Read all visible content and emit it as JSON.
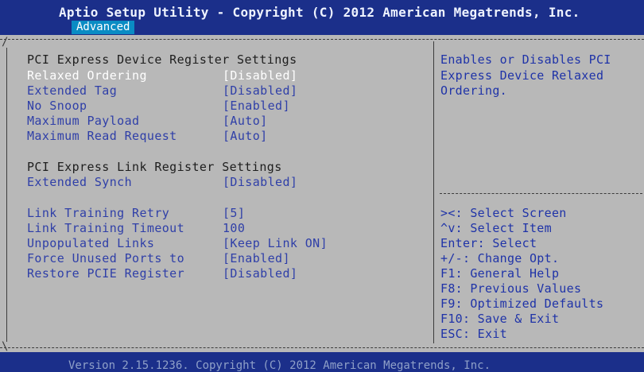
{
  "header": {
    "title": "Aptio Setup Utility - Copyright (C) 2012 American Megatrends, Inc.",
    "active_tab": "Advanced"
  },
  "settings": {
    "section1_title": "PCI Express Device Register Settings",
    "section2_title": "PCI Express Link Register Settings",
    "items": [
      {
        "label": "Relaxed Ordering",
        "value": "[Disabled]"
      },
      {
        "label": "Extended Tag",
        "value": "[Disabled]"
      },
      {
        "label": "No Snoop",
        "value": "[Enabled]"
      },
      {
        "label": "Maximum Payload",
        "value": "[Auto]"
      },
      {
        "label": "Maximum Read Request",
        "value": "[Auto]"
      },
      {
        "label": "Extended Synch",
        "value": "[Disabled]"
      },
      {
        "label": "Link Training Retry",
        "value": "[5]"
      },
      {
        "label": "Link Training Timeout",
        "value": "100"
      },
      {
        "label": "Unpopulated Links",
        "value": "[Keep Link ON]"
      },
      {
        "label": "Force Unused Ports to",
        "value": "[Enabled]"
      },
      {
        "label": "Restore PCIE Register",
        "value": "[Disabled]"
      }
    ]
  },
  "help": {
    "lines": [
      "Enables or Disables PCI",
      "Express Device Relaxed",
      "Ordering."
    ],
    "keys": [
      "><: Select Screen",
      "^v: Select Item",
      "Enter: Select",
      "+/-: Change Opt.",
      "F1: General Help",
      "F8: Previous Values",
      "F9: Optimized Defaults",
      "F10: Save & Exit",
      "ESC: Exit"
    ]
  },
  "footer": {
    "text": "Version 2.15.1236. Copyright (C) 2012 American Megatrends, Inc."
  }
}
